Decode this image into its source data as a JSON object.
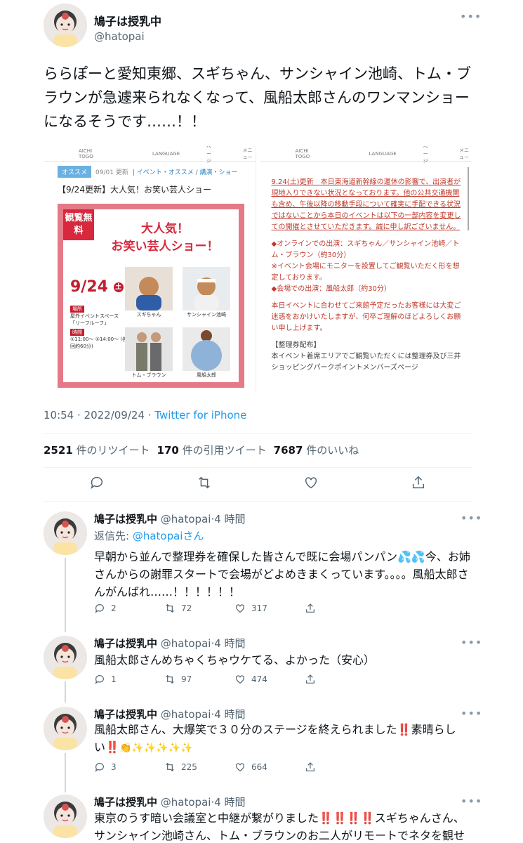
{
  "main_tweet": {
    "name": "鳩子は授乳中",
    "handle": "@hatopai",
    "text": "ららぽーと愛知東郷、スギちゃん、サンシャイン池崎、トム・ブラウンが急遽来られなくなって、風船太郎さんのワンマンショーになるそうです……！！",
    "time": "10:54 · 2022/09/24 · ",
    "source": "Twitter for iPhone",
    "retweets": "2521",
    "retweets_label": "件のリツイート",
    "quotes": "170",
    "quotes_label": "件の引用ツイート",
    "likes": "7687",
    "likes_label": "件のいいね"
  },
  "media_left": {
    "header_logo": "AICHI TOGO",
    "header_lang": "LANGUAGE",
    "header_page": "ページ",
    "header_menu": "メニュー",
    "tag": "オススメ",
    "date": "09/01 更新",
    "category": "| イベント・オススメ / 講演・ショー",
    "headline": "【9/24更新】大人気！お笑い芸人ショー",
    "badge": "観覧無料",
    "flyer_title_1": "大人気！",
    "flyer_title_2": "お笑い芸人ショー！",
    "flyer_date": "9/24",
    "flyer_day": "土",
    "venue_label": "場所",
    "venue": "屋外イベントスペース「リーフルーフ」",
    "time_label": "時間",
    "times": "①11:00〜 ②14:00〜 (各回約60分)",
    "performers": [
      "スギちゃん",
      "サンシャイン池崎",
      "トム・ブラウン",
      "風船太郎"
    ]
  },
  "media_right": {
    "header_logo": "AICHI TOGO",
    "header_lang": "LANGUAGE",
    "header_page": "ページ",
    "header_menu": "メニュー",
    "notice_1": "9.24(土)更新　本日東海道新幹線の運休の影響で、出演者が現地入りできない状況となっております。他の公共交通機関も含め、午後以降の移動手段について確実に手配できる状況ではないことから本日のイベントは以下の一部内容を変更しての開催とさせていただきます。誠に申し訳ございません。",
    "notice_2": "◆オンラインでの出演：スギちゃん／サンシャイン池崎／トム・ブラウン（約30分）",
    "notice_3": "※イベント会場にモニターを設置してご観覧いただく形を想定しております。",
    "notice_4": "◆会場での出演：風船太郎（約30分）",
    "notice_5": "本日イベントに合わせてご来館予定だったお客様には大変ご迷惑をおかけいたしますが、何卒ご理解のほどよろしくお願い申し上げます。",
    "notice_6": "【整理券配布】",
    "notice_7": "本イベント着席エリアでご観覧いただくには整理券及び三井ショッピングパークポイントメンバーズページ"
  },
  "replies": [
    {
      "name": "鳩子は授乳中",
      "handle": "@hatopai",
      "time": "·4 時間",
      "reply_to_label": "返信先: ",
      "reply_to": "@hatopaiさん",
      "text": "早朝から並んで整理券を確保した皆さんで既に会場パンパン💦💦今、お姉さんからの謝罪スタートで会場がどよめきまくっています。。。。風船太郎さんがんばれ……！！！！！！",
      "replies": "2",
      "retweets": "72",
      "likes": "317"
    },
    {
      "name": "鳩子は授乳中",
      "handle": "@hatopai",
      "time": "·4 時間",
      "text": "風船太郎さんめちゃくちゃウケてる、よかった（安心）",
      "replies": "1",
      "retweets": "97",
      "likes": "474"
    },
    {
      "name": "鳩子は授乳中",
      "handle": "@hatopai",
      "time": "·4 時間",
      "text_a": "風船太郎さん、大爆笑で３０分のステージを終えられました",
      "text_b": "素晴らしい",
      "text_c": "👏✨✨✨✨✨",
      "bang": "‼️",
      "replies": "3",
      "retweets": "225",
      "likes": "664"
    },
    {
      "name": "鳩子は授乳中",
      "handle": "@hatopai",
      "time": "·4 時間",
      "text_a": "東京のうす暗い会議室と中継が繋がりました",
      "bangs": "‼️‼️‼️‼️",
      "text_b": "スギちゃんさん、サンシャイン池崎さん、トム・ブラウンのお二人がリモートでネタを観せて"
    }
  ],
  "colors": {
    "link": "#1d9bf0",
    "muted": "#536471",
    "accent_red": "#c21d2f"
  },
  "icons": [
    "more-icon",
    "reply-icon",
    "retweet-icon",
    "like-icon",
    "share-icon"
  ]
}
